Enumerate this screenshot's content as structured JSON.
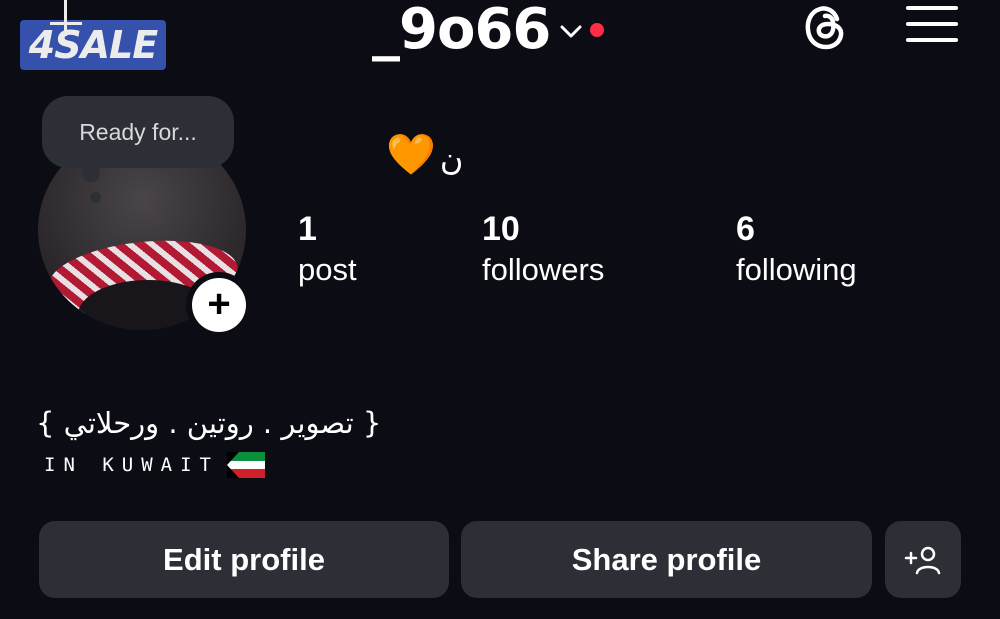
{
  "watermark": {
    "text": "4SALE"
  },
  "header": {
    "username": "_9o66",
    "threads_icon": "threads-icon",
    "menu_icon": "hamburger-menu-icon",
    "notification_dot_color": "#ff2d46"
  },
  "profile": {
    "note": "Ready for...",
    "display_name": "ن",
    "name_emoji": "🧡",
    "stats": [
      {
        "value": "1",
        "label": "post"
      },
      {
        "value": "10",
        "label": "followers"
      },
      {
        "value": "6",
        "label": "following"
      }
    ],
    "bio": "{ تصوير . روتين . ورحلاتي }",
    "location": "IN KUWAIT"
  },
  "actions": {
    "edit_label": "Edit profile",
    "share_label": "Share profile",
    "add_person_icon": "add-person-icon"
  }
}
